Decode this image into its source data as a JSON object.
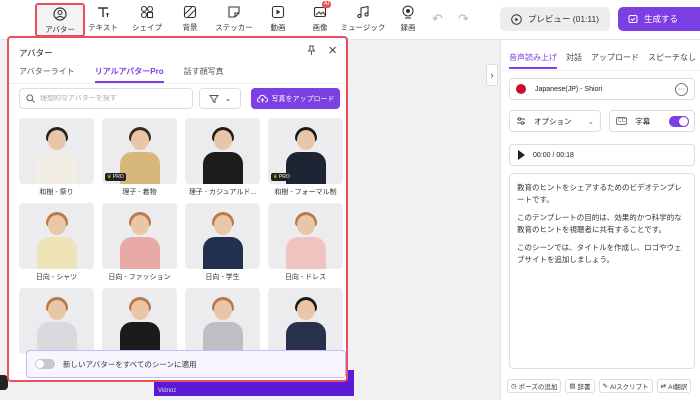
{
  "toolbar": {
    "tools": [
      {
        "label": "アバター",
        "icon": "avatar-icon"
      },
      {
        "label": "テキスト",
        "icon": "text-icon"
      },
      {
        "label": "シェイプ",
        "icon": "shape-icon"
      },
      {
        "label": "背景",
        "icon": "background-icon"
      },
      {
        "label": "ステッカー",
        "icon": "sticker-icon"
      },
      {
        "label": "動画",
        "icon": "video-icon"
      },
      {
        "label": "画像",
        "icon": "image-icon",
        "badge": "AI"
      },
      {
        "label": "ミュージック",
        "icon": "music-icon"
      },
      {
        "label": "録画",
        "icon": "record-icon"
      }
    ],
    "preview_label": "プレビュー (01:11)",
    "generate_label": "生成する"
  },
  "avatar_panel": {
    "title": "アバター",
    "tabs": [
      {
        "label": "アバターライト",
        "active": false
      },
      {
        "label": "リアルアバターPro",
        "active": true
      },
      {
        "label": "話す顔写真",
        "active": false
      }
    ],
    "search_placeholder": "理想的なアバターを探す",
    "upload_label": "写真をアップロード",
    "avatars": [
      {
        "name": "和樹 - 祭り",
        "pro": false
      },
      {
        "name": "理子 - 着物",
        "pro": true
      },
      {
        "name": "理子 - カジュアルド...",
        "pro": false
      },
      {
        "name": "和樹 - フォーマル制",
        "pro": true
      },
      {
        "name": "日向 - シャツ",
        "pro": false
      },
      {
        "name": "日向 - ファッション",
        "pro": false
      },
      {
        "name": "日向 - 学生",
        "pro": false
      },
      {
        "name": "日向 - ドレス",
        "pro": false
      },
      {
        "name": "",
        "pro": false
      },
      {
        "name": "",
        "pro": false
      },
      {
        "name": "",
        "pro": false
      },
      {
        "name": "",
        "pro": false
      }
    ],
    "pro_badge": "PRO",
    "apply_all_label": "新しいアバターをすべてのシーンに適用"
  },
  "right_panel": {
    "tabs": [
      {
        "label": "音声読み上げ",
        "active": true
      },
      {
        "label": "対話",
        "active": false
      },
      {
        "label": "アップロード",
        "active": false
      },
      {
        "label": "スピーチなし",
        "active": false
      }
    ],
    "voice": "Japanese(JP) - Shiori",
    "options_label": "オプション",
    "subtitles_label": "字幕",
    "cc_label": "CC",
    "time": "00:00 / 00:18",
    "script": [
      "教育のヒントをシェアするためのビデオテンプレートです。",
      "このテンプレートの目的は、効果的かつ科学的な教育のヒントを視聴者に共有することです。",
      "このシーンでは、タイトルを作成し、ロゴやウェブサイトを追加しましょう。"
    ],
    "footer": [
      {
        "label": "ポーズの追加",
        "icon": "clock-icon"
      },
      {
        "label": "辞書",
        "icon": "book-icon"
      },
      {
        "label": "AIスクリプト",
        "icon": "ai-script-icon"
      },
      {
        "label": "AI翻訳",
        "icon": "translate-icon"
      }
    ]
  },
  "canvas": {
    "watermark": "Vidnoz"
  },
  "colors": {
    "accent": "#7b3fe4",
    "highlight": "#e8505b"
  }
}
